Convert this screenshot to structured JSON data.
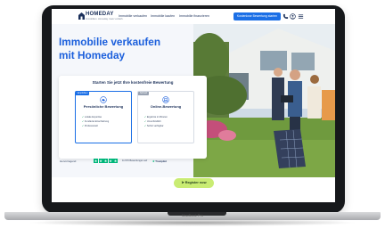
{
  "device": {
    "base_label": "MacBook Pro"
  },
  "nav": {
    "brand": "HOMEDAY",
    "tagline": "Immobilien. Homeday. Ganz einfach.",
    "links": [
      "Immobilie verkaufen",
      "Immobilie kaufen",
      "Immobilie finanzieren"
    ],
    "cta": "Kostenlose Bewertung starten"
  },
  "hero": {
    "title_line1": "Immobilie verkaufen",
    "title_line2": "mit Homeday"
  },
  "card": {
    "title": "Starten Sie jetzt Ihre kostenfreie Bewertung",
    "options": [
      {
        "tag": "Empfohlen",
        "title": "Persönliche Bewertung",
        "features": [
          "Lokale Expertise",
          "Fundierte Einschätzung",
          "Professionell"
        ]
      },
      {
        "tag": "Schnell",
        "title": "Online-Bewertung",
        "features": [
          "Ergebnis in Minuten",
          "Unverbindlich",
          "Sofort verfügbar"
        ]
      }
    ],
    "rating_label": "Hervorragend",
    "reviews": "11.570 Bewertungen auf",
    "trustpilot": "Trustpilot"
  },
  "register_label": "Register now",
  "colors": {
    "primary_blue": "#1b5fdc",
    "cta_blue": "#1b6fe6",
    "register_green": "#c9ec73",
    "trustpilot_green": "#00b67a"
  }
}
